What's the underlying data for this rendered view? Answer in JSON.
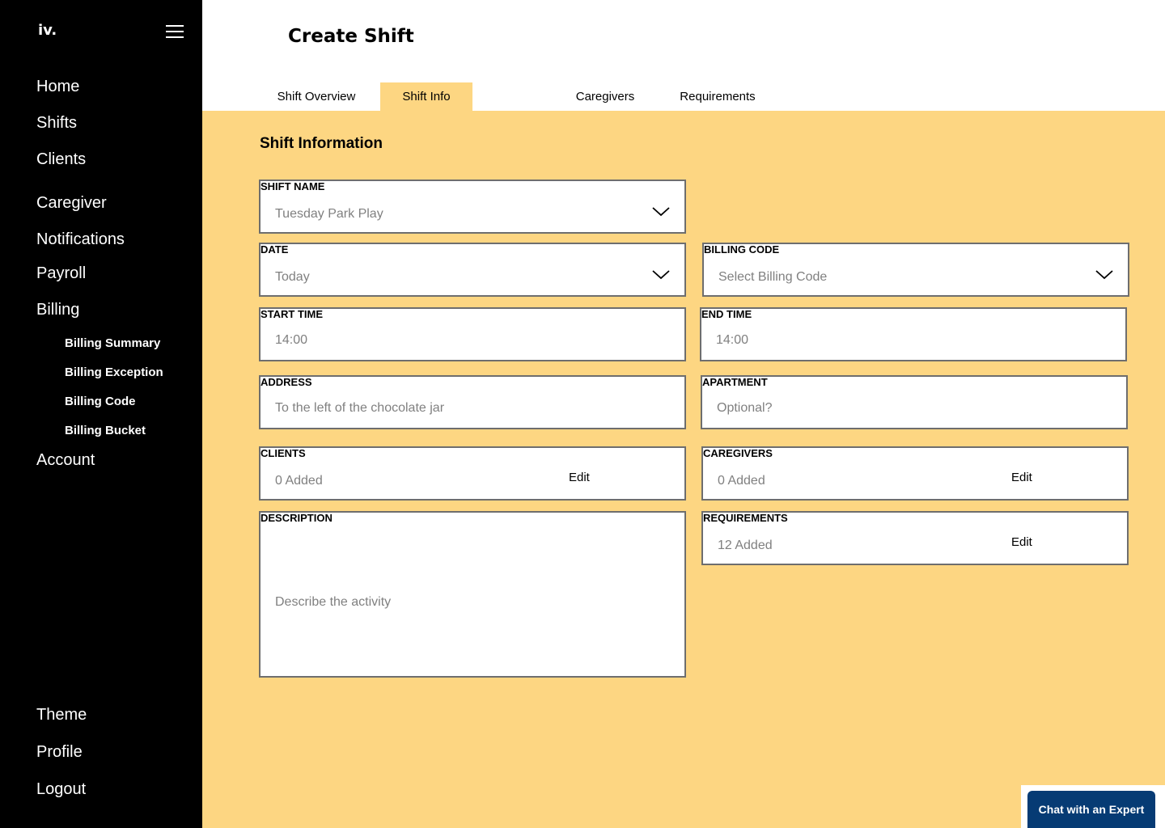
{
  "app": {
    "logo": "iv."
  },
  "sidebar": {
    "items": [
      {
        "label": "Home"
      },
      {
        "label": "Shifts"
      },
      {
        "label": "Clients"
      },
      {
        "label": "Caregiver"
      },
      {
        "label": "Notifications"
      },
      {
        "label": "Payroll"
      },
      {
        "label": "Billing"
      },
      {
        "label": "Account"
      }
    ],
    "billing_sub": [
      {
        "label": "Billing Summary"
      },
      {
        "label": "Billing Exception"
      },
      {
        "label": "Billing Code"
      },
      {
        "label": "Billing Bucket"
      }
    ],
    "bottom": [
      {
        "label": "Theme"
      },
      {
        "label": "Profile"
      },
      {
        "label": "Logout"
      }
    ]
  },
  "header": {
    "title": "Create Shift",
    "tabs": [
      {
        "label": "Shift Overview"
      },
      {
        "label": "Shift Info"
      },
      {
        "label": "Caregivers"
      },
      {
        "label": "Requirements"
      }
    ],
    "active_tab": "Shift Info"
  },
  "form": {
    "section_title": "Shift Information",
    "shift_name": {
      "label": "SHIFT NAME",
      "value": "Tuesday Park Play"
    },
    "date": {
      "label": "DATE",
      "value": "Today"
    },
    "billing_code": {
      "label": "BILLING CODE",
      "placeholder": "Select Billing Code"
    },
    "start_time": {
      "label": "START TIME",
      "placeholder": "14:00"
    },
    "end_time": {
      "label": "END TIME",
      "placeholder": "14:00"
    },
    "address": {
      "label": "ADDRESS",
      "placeholder": "To the left of the chocolate jar"
    },
    "apartment": {
      "label": "APARTMENT",
      "placeholder": "Optional?"
    },
    "clients": {
      "label": "CLIENTS",
      "value": "0 Added",
      "edit": "Edit"
    },
    "caregivers": {
      "label": "CAREGIVERS",
      "value": "0 Added",
      "edit": "Edit"
    },
    "description": {
      "label": "DESCRIPTION",
      "placeholder": "Describe the activity"
    },
    "requirements": {
      "label": "REQUIREMENTS",
      "value": "12 Added",
      "edit": "Edit"
    }
  },
  "chat": {
    "label": "Chat with an Expert"
  },
  "colors": {
    "accent": "#fdd682",
    "sidebar": "#000000",
    "chat": "#063b74"
  }
}
